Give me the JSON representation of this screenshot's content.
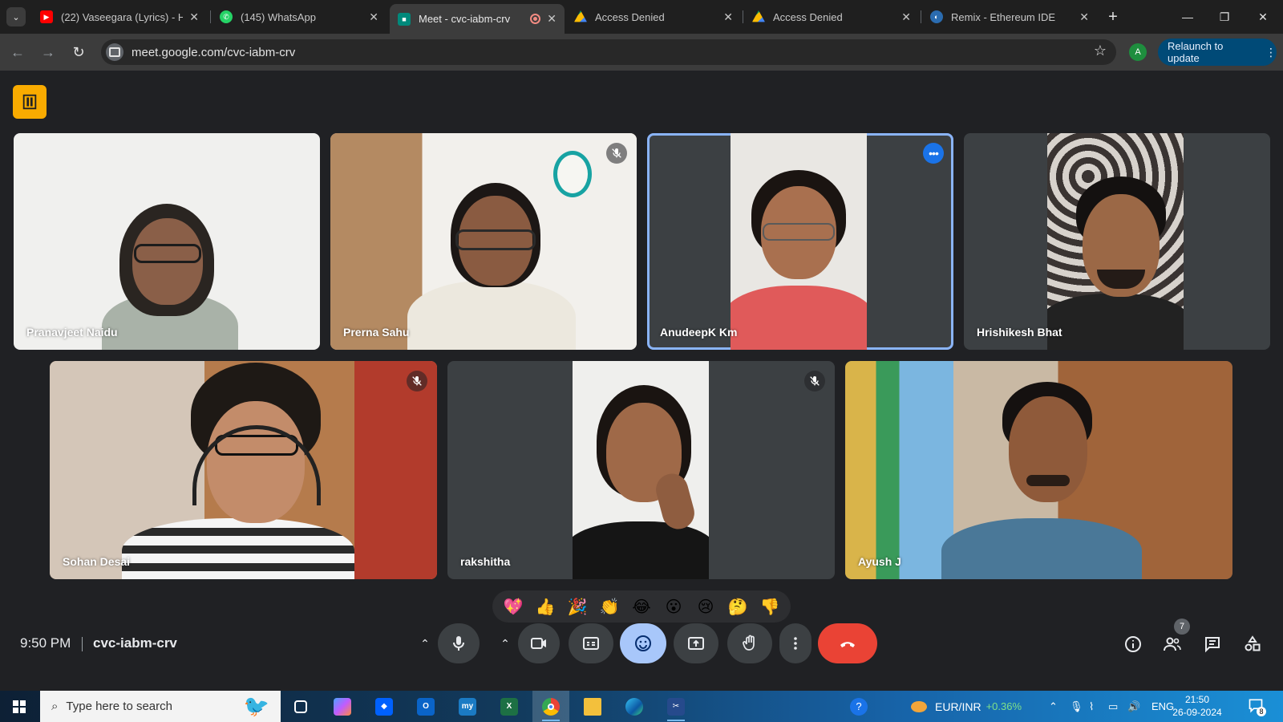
{
  "browser": {
    "tabs": [
      {
        "label": "(22) Vaseegara (Lyrics) - H",
        "favicon": "youtube-icon",
        "color": "#ff0000"
      },
      {
        "label": "(145) WhatsApp",
        "favicon": "whatsapp-icon",
        "color": "#25d366"
      },
      {
        "label": "Meet - cvc-iabm-crv",
        "favicon": "meet-icon",
        "color": "#00897b",
        "active": true,
        "recording": true
      },
      {
        "label": "Access Denied",
        "favicon": "drive-icon",
        "color": "#fbbc04"
      },
      {
        "label": "Access Denied",
        "favicon": "drive-icon",
        "color": "#fbbc04"
      },
      {
        "label": "Remix - Ethereum IDE",
        "favicon": "remix-icon",
        "color": "#2b6cb0"
      }
    ],
    "url": "meet.google.com/cvc-iabm-crv",
    "profile_initial": "A",
    "relaunch_label": "Relaunch to update"
  },
  "meet": {
    "participants": [
      {
        "name": "Pranavjeet Naidu",
        "muted": false,
        "speaking": false
      },
      {
        "name": "Prerna Sahu",
        "muted": true,
        "speaking": false
      },
      {
        "name": "AnudeepK Km",
        "muted": false,
        "speaking": true
      },
      {
        "name": "Hrishikesh Bhat",
        "muted": false,
        "speaking": false
      },
      {
        "name": "Sohan Desai",
        "muted": true,
        "speaking": false
      },
      {
        "name": "rakshitha",
        "muted": true,
        "speaking": false
      },
      {
        "name": "Ayush J",
        "muted": false,
        "speaking": false
      }
    ],
    "reactions": [
      "💖",
      "👍",
      "🎉",
      "👏",
      "😂",
      "😮",
      "😢",
      "🤔",
      "👎"
    ],
    "time": "9:50 PM",
    "meeting_code": "cvc-iabm-crv",
    "people_count": "7",
    "colors": {
      "accent": "#8ab4f8",
      "end_call": "#ea4335",
      "reaction_active": "#a8c7fa"
    }
  },
  "taskbar": {
    "search_placeholder": "Type here to search",
    "currency": "EUR/INR",
    "currency_change": "+0.36%",
    "language": "ENG",
    "time": "21:50",
    "date": "26-09-2024",
    "notification_count": "8"
  }
}
